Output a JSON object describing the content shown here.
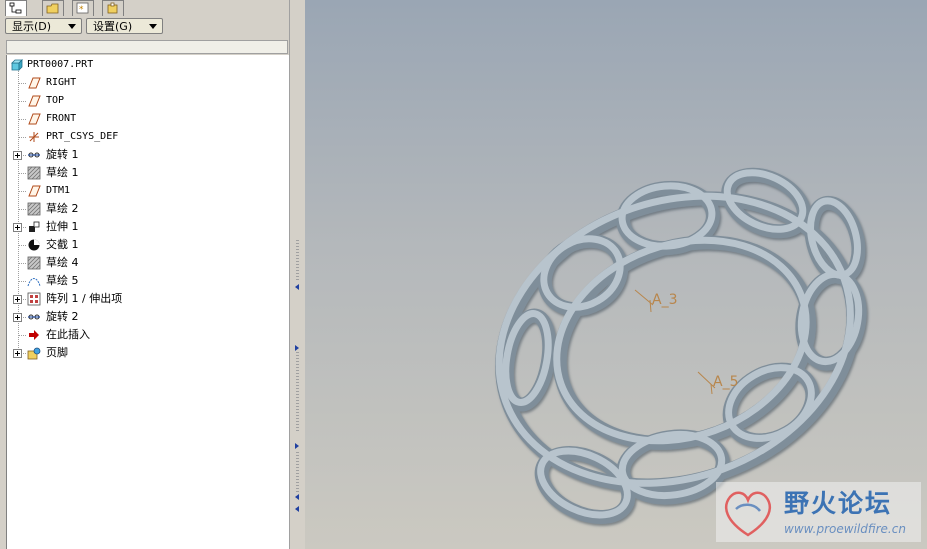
{
  "menus": {
    "display": "显示(D)",
    "settings": "设置(G)"
  },
  "tree": {
    "root": "PRT0007.PRT",
    "items": [
      {
        "label": "RIGHT",
        "icon": "datum-plane-icon",
        "expandable": false,
        "cjk": false
      },
      {
        "label": "TOP",
        "icon": "datum-plane-icon",
        "expandable": false,
        "cjk": false
      },
      {
        "label": "FRONT",
        "icon": "datum-plane-icon",
        "expandable": false,
        "cjk": false
      },
      {
        "label": "PRT_CSYS_DEF",
        "icon": "coordinate-system-icon",
        "expandable": false,
        "cjk": false
      },
      {
        "label": "旋转 1",
        "icon": "revolve-icon",
        "expandable": true,
        "cjk": true
      },
      {
        "label": "草绘 1",
        "icon": "sketch-icon",
        "expandable": false,
        "cjk": true
      },
      {
        "label": "DTM1",
        "icon": "datum-plane-icon",
        "expandable": false,
        "cjk": false
      },
      {
        "label": "草绘 2",
        "icon": "sketch-icon",
        "expandable": false,
        "cjk": true
      },
      {
        "label": "拉伸 1",
        "icon": "extrude-icon",
        "expandable": true,
        "cjk": true
      },
      {
        "label": "交截 1",
        "icon": "intersect-icon",
        "expandable": false,
        "cjk": true
      },
      {
        "label": "草绘 4",
        "icon": "sketch-icon",
        "expandable": false,
        "cjk": true
      },
      {
        "label": "草绘 5",
        "icon": "curve-sketch-icon",
        "expandable": false,
        "cjk": true
      },
      {
        "label": "阵列 1 / 伸出项",
        "icon": "pattern-icon",
        "expandable": true,
        "cjk": true
      },
      {
        "label": "旋转 2",
        "icon": "revolve-icon",
        "expandable": true,
        "cjk": true
      },
      {
        "label": "在此插入",
        "icon": "insert-here-arrow-icon",
        "expandable": false,
        "cjk": true
      },
      {
        "label": "页脚",
        "icon": "footer-icon",
        "expandable": true,
        "cjk": true
      }
    ]
  },
  "viewport": {
    "annotations": [
      {
        "text": "A_3"
      },
      {
        "text": "A_5"
      }
    ]
  },
  "watermark": {
    "title": "野火论坛",
    "url": "www.proewildfire.cn"
  },
  "colors": {
    "model": "#9aa9b5",
    "annotation": "#b8864c",
    "insert_arrow": "#c00000"
  }
}
